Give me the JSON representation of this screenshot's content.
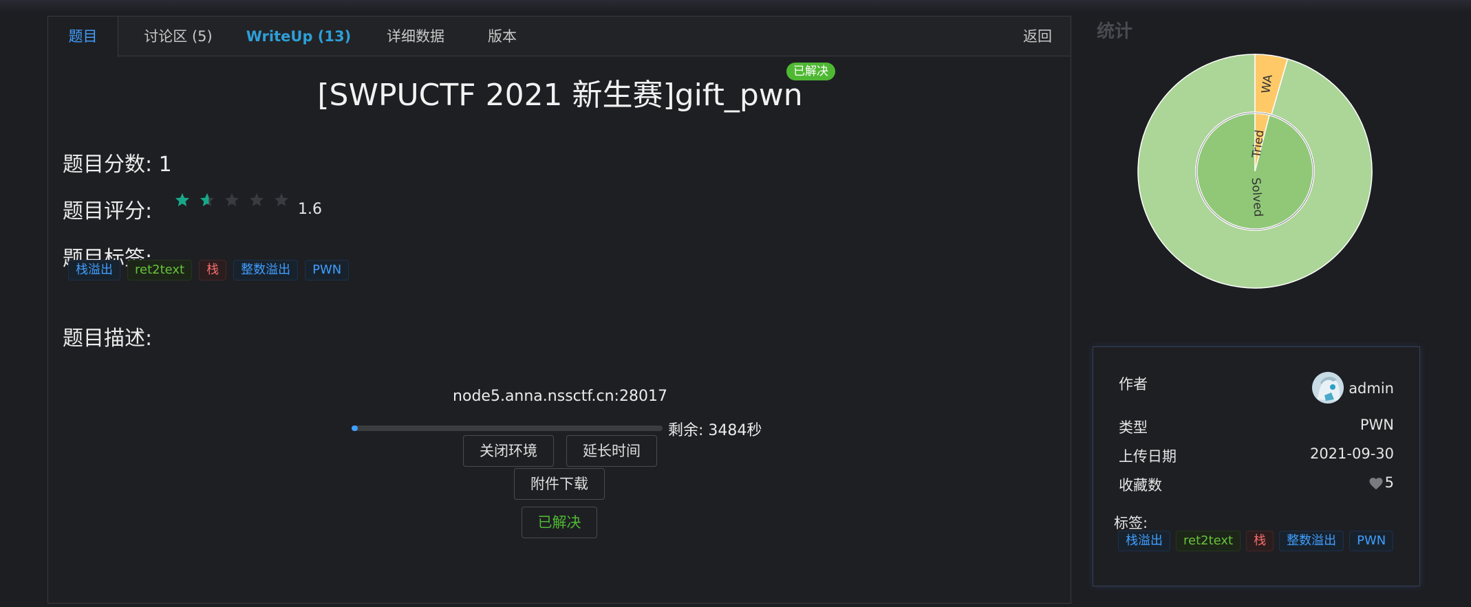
{
  "tabs": [
    {
      "label": "题目"
    },
    {
      "label": "讨论区 (5)"
    },
    {
      "label": "WriteUp (13)"
    },
    {
      "label": "详细数据"
    },
    {
      "label": "版本"
    }
  ],
  "back_label": "返回",
  "problem": {
    "title": "[SWPUCTF 2021 新生赛]gift_pwn",
    "solved_badge": "已解决",
    "score_label": "题目分数:",
    "score_value": "1",
    "rating_label": "题目评分:",
    "rating_value": "1.6",
    "rating_stars_max": 5,
    "tags_label": "题目标签:",
    "tags": [
      {
        "text": "栈溢出",
        "color": "blue"
      },
      {
        "text": "ret2text",
        "color": "green"
      },
      {
        "text": "栈",
        "color": "red"
      },
      {
        "text": "整数溢出",
        "color": "blue"
      },
      {
        "text": "PWN",
        "color": "blue"
      }
    ],
    "desc_label": "题目描述:"
  },
  "environment": {
    "address": "node5.anna.nssctf.cn:28017",
    "progress_fraction": 0.02,
    "remaining": "剩余: 3484秒",
    "close_button": "关闭环境",
    "extend_button": "延长时间",
    "download_button": "附件下载",
    "solved_button": "已解决"
  },
  "stats": {
    "title": "统计"
  },
  "chart_data": {
    "type": "pie",
    "outer": [
      {
        "label": "WA",
        "value": 0.045,
        "color": "#ffc968"
      },
      {
        "label": "",
        "value": 0.955,
        "color": "#acd598"
      }
    ],
    "inner": [
      {
        "label": "Tried",
        "value": 0.04,
        "color": "#ffc968"
      },
      {
        "label": "Solved",
        "value": 0.96,
        "color": "#90c878"
      }
    ]
  },
  "info": {
    "author_label": "作者",
    "author_name": "admin",
    "type_label": "类型",
    "type_value": "PWN",
    "date_label": "上传日期",
    "date_value": "2021-09-30",
    "fav_label": "收藏数",
    "fav_value": "5",
    "tags_label": "标签:",
    "tags": [
      {
        "text": "栈溢出",
        "color": "blue"
      },
      {
        "text": "ret2text",
        "color": "green"
      },
      {
        "text": "栈",
        "color": "red"
      },
      {
        "text": "整数溢出",
        "color": "blue"
      },
      {
        "text": "PWN",
        "color": "blue"
      }
    ]
  },
  "colors": {
    "accent": "#409eff",
    "star_active": "#17a88a",
    "star_inactive": "#3a3b40",
    "solved_green": "#4fb833"
  }
}
